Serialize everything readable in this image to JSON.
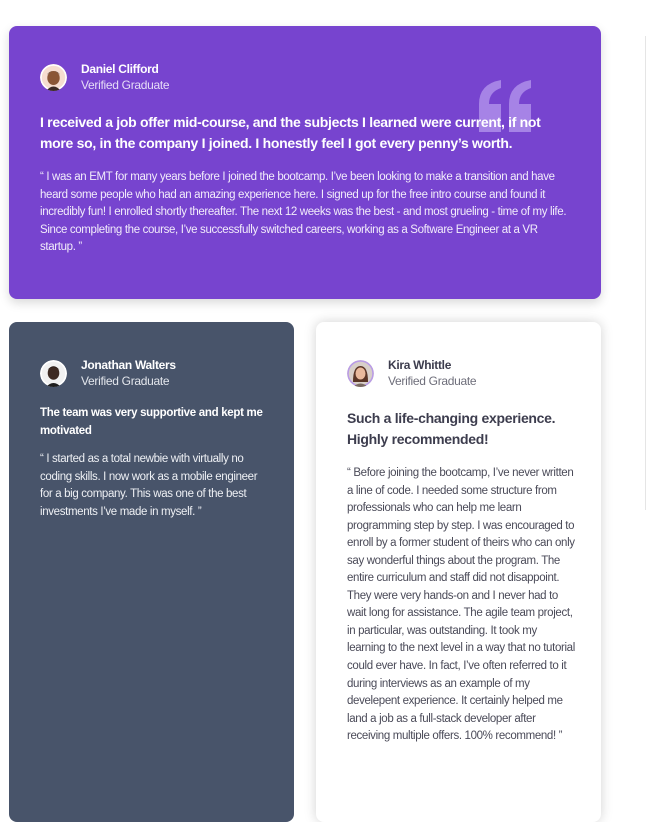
{
  "testimonials": [
    {
      "name": "Daniel Clifford",
      "role": "Verified Graduate",
      "headline": "I received a job offer mid-course, and the subjects I learned were current, if not more so, in the company I joined. I honestly feel I got every penny’s worth.",
      "body": "“ I was an EMT for many years before I joined the bootcamp. I’ve been looking to make a transition and have heard some people who had an amazing experience here. I signed up for the free intro course and found it incredibly fun! I enrolled shortly thereafter. The next 12 weeks was the best - and most grueling - time of my life. Since completing the course, I’ve successfully switched careers, working as a Software Engineer at a VR startup. ”",
      "bg_color": "#7744cf"
    },
    {
      "name": "Jonathan Walters",
      "role": "Verified Graduate",
      "headline": "The team was very supportive and kept me motivated",
      "body": "“ I started as a total newbie with virtually no coding skills. I now work as a mobile engineer for a big company. This was one of the best investments I’ve made in myself. ”",
      "bg_color": "#48546a"
    },
    {
      "name": "Kira Whittle",
      "role": "Verified Graduate",
      "headline": "Such a life-changing experience. Highly recommended!",
      "body": "“ Before joining the bootcamp, I’ve never written a line of code. I needed some structure from professionals who can help me learn programming step by step. I was encouraged to enroll by a former student of theirs who can only say wonderful things about the program. The entire curriculum and staff did not disappoint. They were very hands-on and I never had to wait long for assistance. The agile team project, in particular, was outstanding. It took my learning to the next level in a way that no tutorial could ever have. In fact, I’ve often referred to it during interviews as an example of my develepent experience. It certainly helped me land a job as a full-stack developer after receiving multiple offers. 100% recommend! ”",
      "bg_color": "#ffffff"
    }
  ],
  "icons": {
    "quote": "quote-icon"
  }
}
